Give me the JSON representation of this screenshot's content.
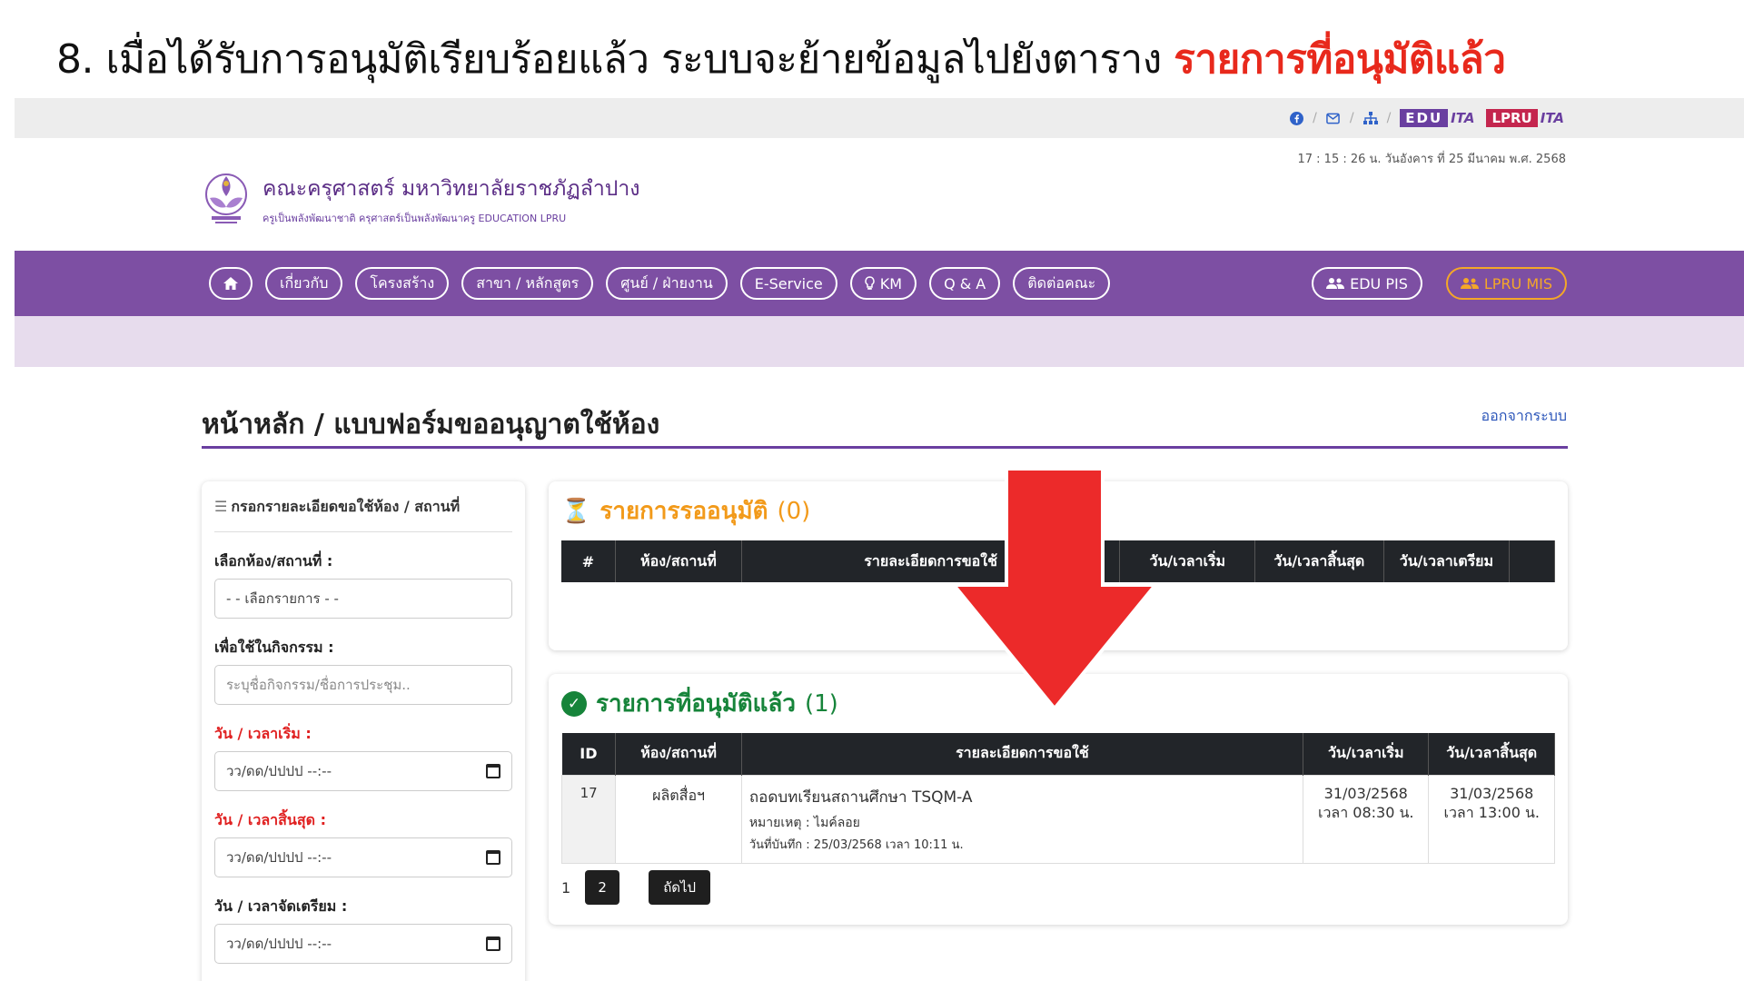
{
  "slide": {
    "step_text": "8. เมื่อได้รับการอนุมัติเรียบร้อยแล้ว ระบบจะย้ายข้อมูลไปยังตาราง",
    "highlight_text": "รายการที่อนุมัติแล้ว"
  },
  "topbar": {
    "icons": [
      "facebook-icon",
      "mail-icon",
      "sitemap-icon"
    ],
    "edu_ita": {
      "box": "EDU",
      "tail": "ITA"
    },
    "lpru_ita": {
      "box": "LPRU",
      "tail": "ITA"
    },
    "clock": "17 : 15 : 26 น.",
    "date": "วันอังคาร ที่ 25 มีนาคม พ.ศ. 2568"
  },
  "logo": {
    "title": "คณะครุศาสตร์ มหาวิทยาลัยราชภัฏลำปาง",
    "tagline": "ครูเป็นพลังพัฒนาชาติ ครุศาสตร์เป็นพลังพัฒนาครู EDUCATION LPRU"
  },
  "nav": {
    "home_icon": "home-icon",
    "items": [
      "เกี่ยวกับ",
      "โครงสร้าง",
      "สาขา / หลักสูตร",
      "ศูนย์ / ฝ่ายงาน",
      "E-Service",
      "KM",
      "Q & A",
      "ติดต่อคณะ"
    ],
    "edu_pis": "EDU PIS",
    "lpru_mis": "LPRU MIS"
  },
  "page": {
    "breadcrumb": "หน้าหลัก / แบบฟอร์มขออนุญาตใช้ห้อง",
    "logout": "ออกจากระบบ"
  },
  "form": {
    "heading": "กรอกรายละเอียดขอใช้ห้อง / สถานที่",
    "room_label": "เลือกห้อง/สถานที่ :",
    "room_value": "- - เลือกรายการ - -",
    "activity_label": "เพื่อใช้ในกิจกรรม :",
    "activity_placeholder": "ระบุชื่อกิจกรรม/ชื่อการประชุม..",
    "start_label": "วัน / เวลาเริ่ม :",
    "end_label": "วัน / เวลาสิ้นสุด :",
    "prep_label": "วัน / เวลาจัดเตรียม :",
    "datetime_placeholder": "วว/ดด/ปปปป --:--"
  },
  "pending": {
    "title": "รายการรออนุมัติ",
    "count": "(0)",
    "columns": [
      "#",
      "ห้อง/สถานที่",
      "รายละเอียดการขอใช้",
      "วัน/เวลาเริ่ม",
      "วัน/เวลาสิ้นสุด",
      "วัน/เวลาเตรียม",
      ""
    ]
  },
  "approved": {
    "title": "รายการที่อนุมัติแล้ว",
    "count": "(1)",
    "columns": [
      "ID",
      "ห้อง/สถานที่",
      "รายละเอียดการขอใช้",
      "วัน/เวลาเริ่ม",
      "วัน/เวลาสิ้นสุด"
    ],
    "rows": [
      {
        "id": "17",
        "room": "ผลิตสื่อฯ",
        "detail": "ถอดบทเรียนสถานศึกษา TSQM-A",
        "note": "หมายเหตุ : ไมค์ลอย",
        "recorded": "วันที่บันทึก : 25/03/2568 เวลา 10:11 น.",
        "start_date": "31/03/2568",
        "start_time": "เวลา 08:30 น.",
        "end_date": "31/03/2568",
        "end_time": "เวลา 13:00 น."
      }
    ]
  },
  "pager": {
    "page1": "1",
    "page2": "2",
    "next": "ถัดไป"
  },
  "colors": {
    "purple": "#7d4fa3",
    "accent_red": "#e8291c",
    "pending_orange": "#f29a1a",
    "approved_green": "#16843a"
  }
}
